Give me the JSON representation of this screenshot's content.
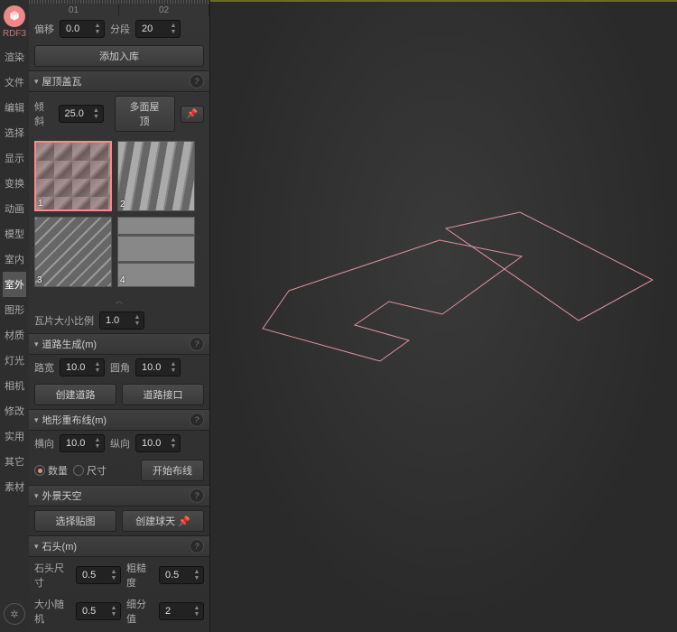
{
  "app_label": "RDF3",
  "left_items": [
    "渲染",
    "文件",
    "编辑",
    "选择",
    "显示",
    "变换",
    "动画",
    "模型",
    "室内",
    "室外",
    "图形",
    "材质",
    "灯光",
    "相机",
    "修改",
    "实用",
    "其它",
    "素材"
  ],
  "left_active": 9,
  "top_tabs": [
    "01",
    "02"
  ],
  "offset": {
    "label": "偏移",
    "value": "0.0"
  },
  "segments": {
    "label": "分段",
    "value": "20"
  },
  "add_lib": "添加入库",
  "roof": {
    "title": "屋顶盖瓦",
    "tilt_label": "倾斜",
    "tilt_value": "25.0",
    "multiface": "多面屋顶",
    "thumbs": [
      "1",
      "2",
      "3",
      "4"
    ],
    "scale_label": "瓦片大小比例",
    "scale_value": "1.0"
  },
  "road": {
    "title": "道路生成(m)",
    "width_label": "路宽",
    "width_value": "10.0",
    "fillet_label": "圆角",
    "fillet_value": "10.0",
    "create": "创建道路",
    "junction": "道路接口"
  },
  "terrain": {
    "title": "地形重布线(m)",
    "h_label": "横向",
    "h_value": "10.0",
    "v_label": "纵向",
    "v_value": "10.0",
    "r_qty": "数量",
    "r_size": "尺寸",
    "start": "开始布线"
  },
  "sky": {
    "title": "外景天空",
    "pick": "选择贴图",
    "sphere": "创建球天"
  },
  "stone": {
    "title": "石头(m)",
    "size_label": "石头尺寸",
    "size_value": "0.5",
    "rough_label": "粗糙度",
    "rough_value": "0.5",
    "rand_label": "大小随机",
    "rand_value": "0.5",
    "sub_label": "细分值",
    "sub_value": "2"
  }
}
